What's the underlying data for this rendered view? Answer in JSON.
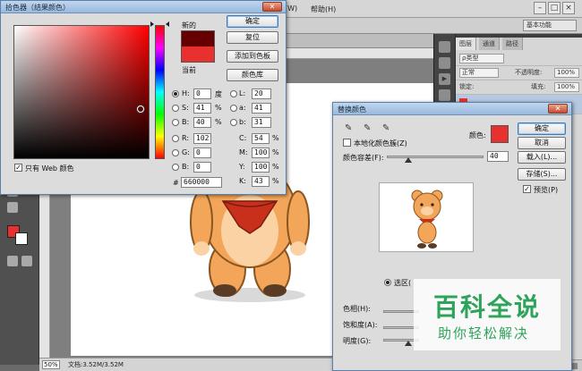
{
  "ps": {
    "menus": [
      "(W)",
      "帮助(H)"
    ],
    "preset": "基本功能",
    "layers": {
      "tabs": [
        "图层",
        "通道",
        "路径"
      ],
      "kind": "ρ类型",
      "blend_mode": "正常",
      "opacity_label": "不透明度:",
      "opacity": "100%",
      "lock_label": "锁定:",
      "fill_label": "填充:",
      "fill": "100%"
    },
    "status": {
      "zoom": "50%",
      "doc": "文档:3.52M/3.52M"
    }
  },
  "color_picker": {
    "title": "拾色器（结果颜色）",
    "new_label": "新的",
    "current_label": "当前",
    "new_color": "#660000",
    "current_color": "#e8312f",
    "buttons": {
      "ok": "确定",
      "reset": "复位",
      "add_swatch": "添加到色板",
      "library": "颜色库"
    },
    "fields": {
      "H": "0",
      "H_unit": "度",
      "S": "41",
      "S_unit": "%",
      "B": "40",
      "B_unit": "%",
      "R": "102",
      "G": "0",
      "Bl": "0",
      "L": "20",
      "a": "41",
      "b": "31",
      "C": "54",
      "M": "100",
      "Y": "100",
      "K": "43",
      "pct": "%",
      "hex": "660000",
      "hash": "#"
    },
    "labels": {
      "H": "H:",
      "S": "S:",
      "B": "B:",
      "R": "R:",
      "G": "G:",
      "Bl": "B:",
      "L": "L:",
      "a": "a:",
      "b": "b:",
      "C": "C:",
      "M": "M:",
      "Y": "Y:",
      "K": "K:"
    },
    "web_only_label": "只有 Web 颜色"
  },
  "replace_color": {
    "title": "替换颜色",
    "localized_label": "本地化颜色簇(Z)",
    "color_label": "颜色:",
    "fuzziness_label": "颜色容差(F):",
    "fuzziness": "40",
    "selection_label": "选区(",
    "hue_label": "色相(H):",
    "saturation_label": "饱和度(A):",
    "lightness_label": "明度(G):",
    "buttons": {
      "ok": "确定",
      "cancel": "取消",
      "load": "载入(L)...",
      "save": "存储(S)..."
    },
    "preview_label": "预览(P)"
  },
  "watermark": {
    "main": "百科全说",
    "sub": "助你轻松解决"
  }
}
